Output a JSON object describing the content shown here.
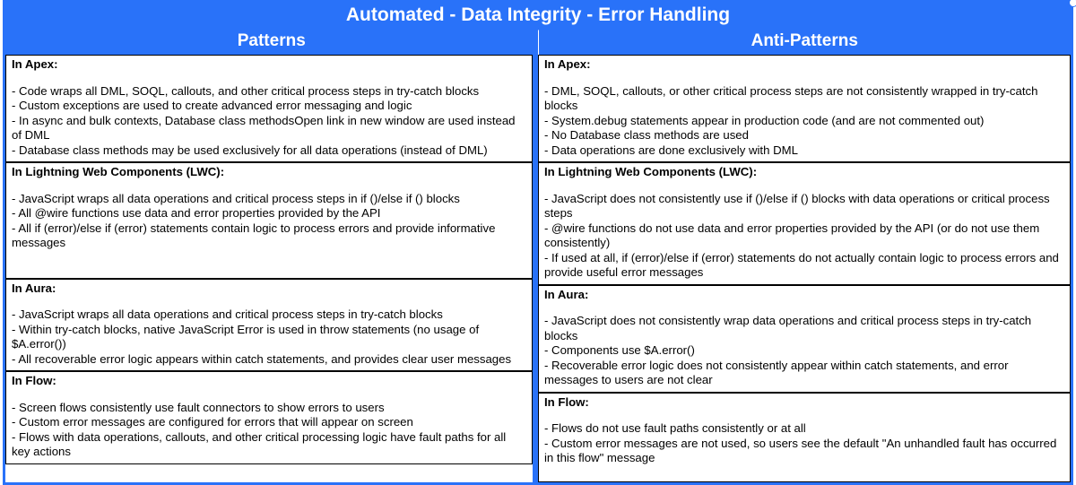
{
  "title": "Automated - Data Integrity - Error Handling",
  "columns": [
    "Patterns",
    "Anti-Patterns"
  ],
  "patterns": {
    "apex": {
      "heading": "In Apex:",
      "lines": [
        "- Code wraps all DML, SOQL, callouts, and other critical process steps in try-catch blocks",
        "- Custom exceptions are used to create advanced error messaging and logic",
        "- In async and bulk contexts, Database class methodsOpen link in new window are used instead of DML",
        "- Database class methods may be used exclusively for all data operations (instead of DML)"
      ]
    },
    "lwc": {
      "heading": "In Lightning Web Components (LWC):",
      "lines": [
        "- JavaScript wraps all data operations and critical process steps in if ()/else if () blocks",
        "- All @wire functions use data and error properties provided by the API",
        "- All if (error)/else if (error) statements contain logic to process errors and provide informative messages"
      ]
    },
    "aura": {
      "heading": "In Aura:",
      "lines": [
        "- JavaScript wraps all data operations and critical process steps in try-catch blocks",
        "- Within try-catch blocks, native JavaScript Error is used in throw statements (no usage of $A.error())",
        "- All recoverable error logic appears within catch statements, and provides clear user messages"
      ]
    },
    "flow": {
      "heading": "In Flow:",
      "lines": [
        "- Screen flows consistently use fault connectors to show errors to users",
        "- Custom error messages are configured for errors that will appear on screen",
        "- Flows with data operations, callouts, and other critical processing logic have fault paths for all key actions"
      ]
    }
  },
  "antipatterns": {
    "apex": {
      "heading": "In Apex:",
      "lines": [
        "- DML, SOQL, callouts, or other critical process steps are not consistently wrapped in try-catch blocks",
        "- System.debug statements appear in production code (and are not commented out)",
        "- No Database class methods are used",
        "- Data operations are done exclusively with DML"
      ]
    },
    "lwc": {
      "heading": "In Lightning Web Components (LWC):",
      "lines": [
        "- JavaScript does not consistently use if ()/else if () blocks with data operations or critical process steps",
        "- @wire functions do not use data and error properties provided by the API (or do not use them consistently)",
        "- If used at all, if (error)/else if (error) statements do not actually contain logic to process errors and provide useful error messages"
      ]
    },
    "aura": {
      "heading": "In Aura:",
      "lines": [
        "- JavaScript does not consistently wrap data operations and critical process steps in try-catch blocks",
        "- Components use $A.error()",
        "- Recoverable error logic does not consistently appear within catch statements, and error messages to users are not clear"
      ]
    },
    "flow": {
      "heading": "In Flow:",
      "lines": [
        "- Flows do not use fault paths consistently or at all",
        "- Custom error messages are not used, so users see the default \"An unhandled fault has occurred in this flow\" message"
      ]
    }
  }
}
